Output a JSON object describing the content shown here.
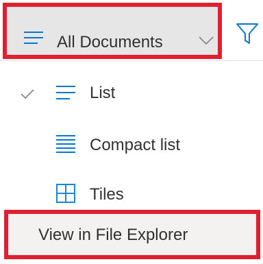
{
  "command_bar": {
    "view_button_label": "All Documents",
    "view_icon": "list-view-icon",
    "dropdown_icon": "chevron-down-icon",
    "filter_icon": "filter-icon"
  },
  "view_menu": {
    "items": [
      {
        "label": "List",
        "icon": "list-icon",
        "selected": true
      },
      {
        "label": "Compact list",
        "icon": "compact-list-icon",
        "selected": false
      },
      {
        "label": "Tiles",
        "icon": "tiles-icon",
        "selected": false
      }
    ],
    "explorer_label": "View in File Explorer"
  },
  "colors": {
    "accent": "#0078d4",
    "highlight_border": "#e0202e",
    "button_bg": "#e6e6e6",
    "text": "#323130"
  }
}
